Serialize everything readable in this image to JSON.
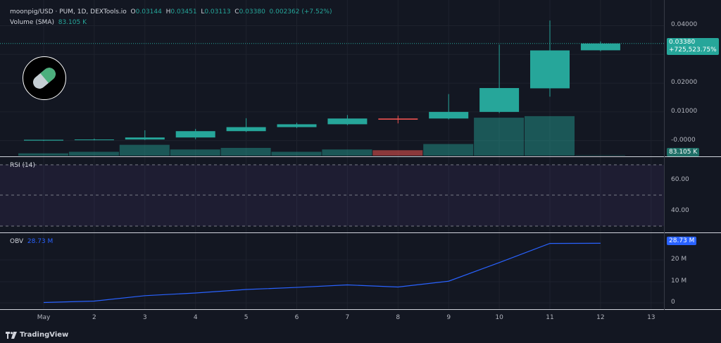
{
  "header": {
    "symbol": "moonpig/USD · PUM, 1D, DEXTools.io",
    "o_label": "O",
    "o": "0.03144",
    "h_label": "H",
    "h": "0.03451",
    "l_label": "L",
    "l": "0.03113",
    "c_label": "C",
    "c": "0.03380",
    "change": "0.002362 (+7.52%)",
    "volume_label": "Volume (SMA)",
    "volume_value": "83.105 K"
  },
  "price_tag": {
    "price": "0.03380",
    "pct": "+725,523.75%"
  },
  "volume_tag": "83.105 K",
  "rsi": {
    "label": "RSI (14)",
    "ticks": [
      "60.00",
      "40.00"
    ]
  },
  "obv": {
    "label": "OBV",
    "value": "28.73 M",
    "ticks": [
      "20 M",
      "10 M",
      "0"
    ]
  },
  "price_ticks": [
    "0.04000",
    "0.03000",
    "0.02000",
    "0.01000",
    "-0.0000"
  ],
  "branding": "TradingView",
  "colors": {
    "up": "#26a69a",
    "down": "#ef5350",
    "obv": "#2962ff",
    "rsi_band": "#7e57c2"
  },
  "chart_data": [
    {
      "type": "candlestick",
      "x": [
        "May",
        "2",
        "3",
        "4",
        "5",
        "6",
        "7",
        "8",
        "9",
        "10",
        "11",
        "12"
      ],
      "x_ticks": [
        "May",
        "2",
        "3",
        "4",
        "5",
        "6",
        "7",
        "8",
        "9",
        "10",
        "11",
        "12",
        "13"
      ],
      "open": [
        0.0,
        0.0003,
        0.0004,
        0.0011,
        0.0033,
        0.0047,
        0.0057,
        0.0077,
        0.0077,
        0.01,
        0.0182,
        0.03144
      ],
      "high": [
        0.0001,
        0.0007,
        0.0036,
        0.0041,
        0.0078,
        0.0062,
        0.0089,
        0.0087,
        0.0162,
        0.0334,
        0.0418,
        0.03451
      ],
      "close": [
        0.0003,
        0.0004,
        0.0011,
        0.0033,
        0.0047,
        0.0057,
        0.0077,
        0.0073,
        0.01,
        0.0183,
        0.0314,
        0.0338
      ],
      "low": [
        -0.0001,
        0.0001,
        0.0002,
        0.0005,
        0.003,
        0.0044,
        0.0054,
        0.006,
        0.0074,
        0.0096,
        0.0153,
        0.03113
      ],
      "ylim": [
        -0.004,
        0.046
      ],
      "volume": [
        3,
        5,
        14,
        8,
        10,
        5,
        8,
        7,
        15,
        49,
        51,
        0.5
      ],
      "volume_up": [
        true,
        true,
        true,
        true,
        true,
        true,
        true,
        false,
        true,
        true,
        true,
        true
      ]
    },
    {
      "type": "line",
      "name": "OBV",
      "x": [
        "May",
        "2",
        "3",
        "4",
        "5",
        "6",
        "7",
        "8",
        "9",
        "10",
        "11",
        "12"
      ],
      "values": [
        0.2,
        0.9,
        3.5,
        4.8,
        6.5,
        7.5,
        8.7,
        7.7,
        10.5,
        19.5,
        28.73,
        28.8
      ],
      "ylim": [
        -2,
        32
      ]
    }
  ]
}
